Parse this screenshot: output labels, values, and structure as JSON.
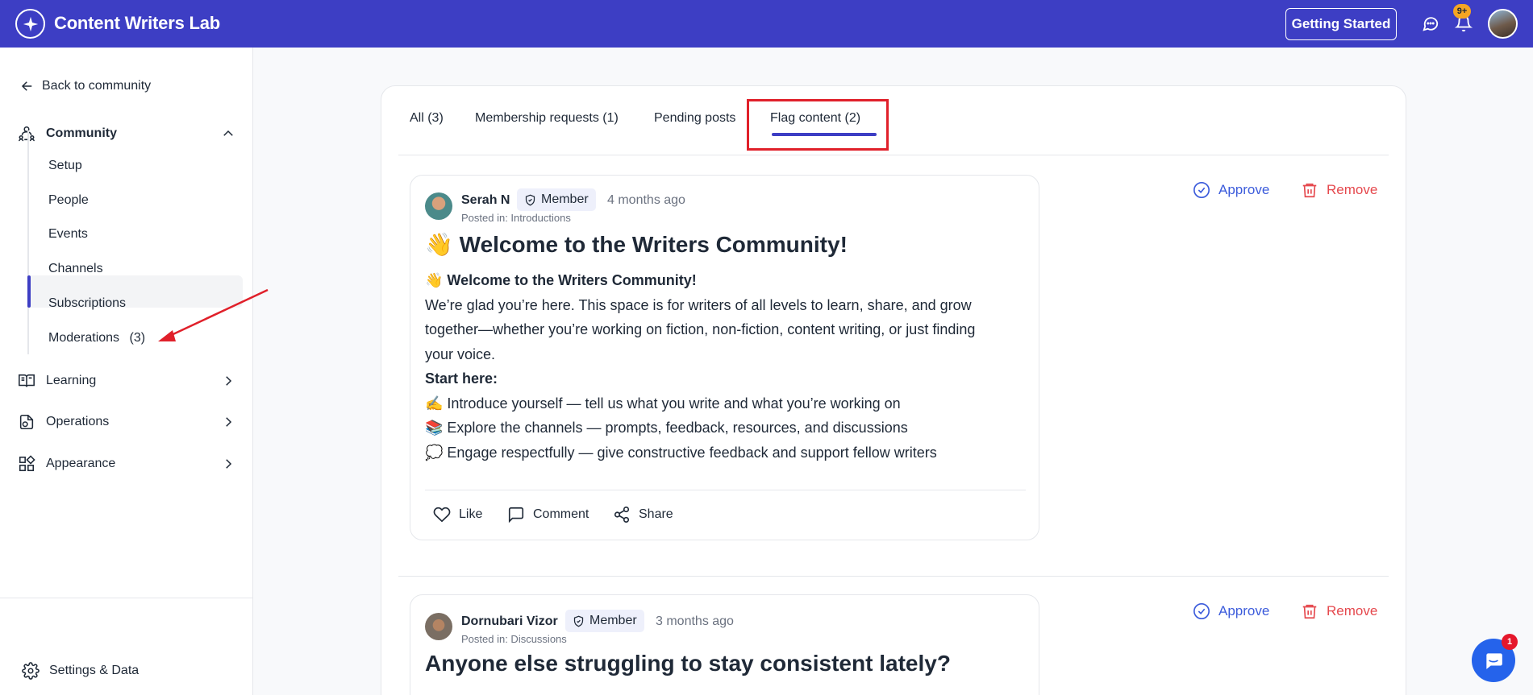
{
  "app": {
    "title": "Content Writers Lab"
  },
  "header": {
    "getting_started": "Getting Started",
    "notifications_badge": "9+"
  },
  "sidebar": {
    "back": "Back to community",
    "community": "Community",
    "sub_items": [
      {
        "label": "Setup"
      },
      {
        "label": "People"
      },
      {
        "label": "Events"
      },
      {
        "label": "Channels"
      },
      {
        "label": "Subscriptions"
      },
      {
        "label": "Moderations",
        "count": "(3)"
      }
    ],
    "learning": "Learning",
    "operations": "Operations",
    "appearance": "Appearance",
    "settings": "Settings & Data"
  },
  "tabs": [
    {
      "label": "All (3)"
    },
    {
      "label": "Membership requests (1)"
    },
    {
      "label": "Pending posts"
    },
    {
      "label": "Flag content (2)",
      "active": true
    }
  ],
  "posts": [
    {
      "author": "Serah N",
      "role": "Member",
      "time": "4 months ago",
      "posted_in": "Posted in: Introductions",
      "title": "👋 Welcome to the Writers Community!",
      "body": [
        {
          "text": "👋 Welcome to the Writers Community!",
          "bold": true
        },
        {
          "text": "We’re glad you’re here. This space is for writers of all levels to learn, share, and grow"
        },
        {
          "text": "together—whether you’re working on fiction, non-fiction, content writing, or just finding"
        },
        {
          "text": "your voice."
        },
        {
          "text": "Start here:",
          "bold": true
        },
        {
          "text": "✍️ Introduce yourself — tell us what you write and what you’re working on"
        },
        {
          "text": "📚 Explore the channels — prompts, feedback, resources, and discussions"
        },
        {
          "text": "💭 Engage respectfully — give constructive feedback and support fellow writers"
        }
      ],
      "actions": {
        "like": "Like",
        "comment": "Comment",
        "share": "Share"
      },
      "approve": "Approve",
      "remove": "Remove"
    },
    {
      "author": "Dornubari Vizor",
      "role": "Member",
      "time": "3 months ago",
      "posted_in": "Posted in: Discussions",
      "title": "Anyone else struggling to stay consistent lately?",
      "approve": "Approve",
      "remove": "Remove"
    }
  ],
  "chat": {
    "badge": "1"
  },
  "colors": {
    "brand": "#3d3ec4",
    "approve": "#3b5bdb",
    "remove": "#e5484d",
    "highlight": "#e0202a",
    "arrow": "#e0202a"
  }
}
